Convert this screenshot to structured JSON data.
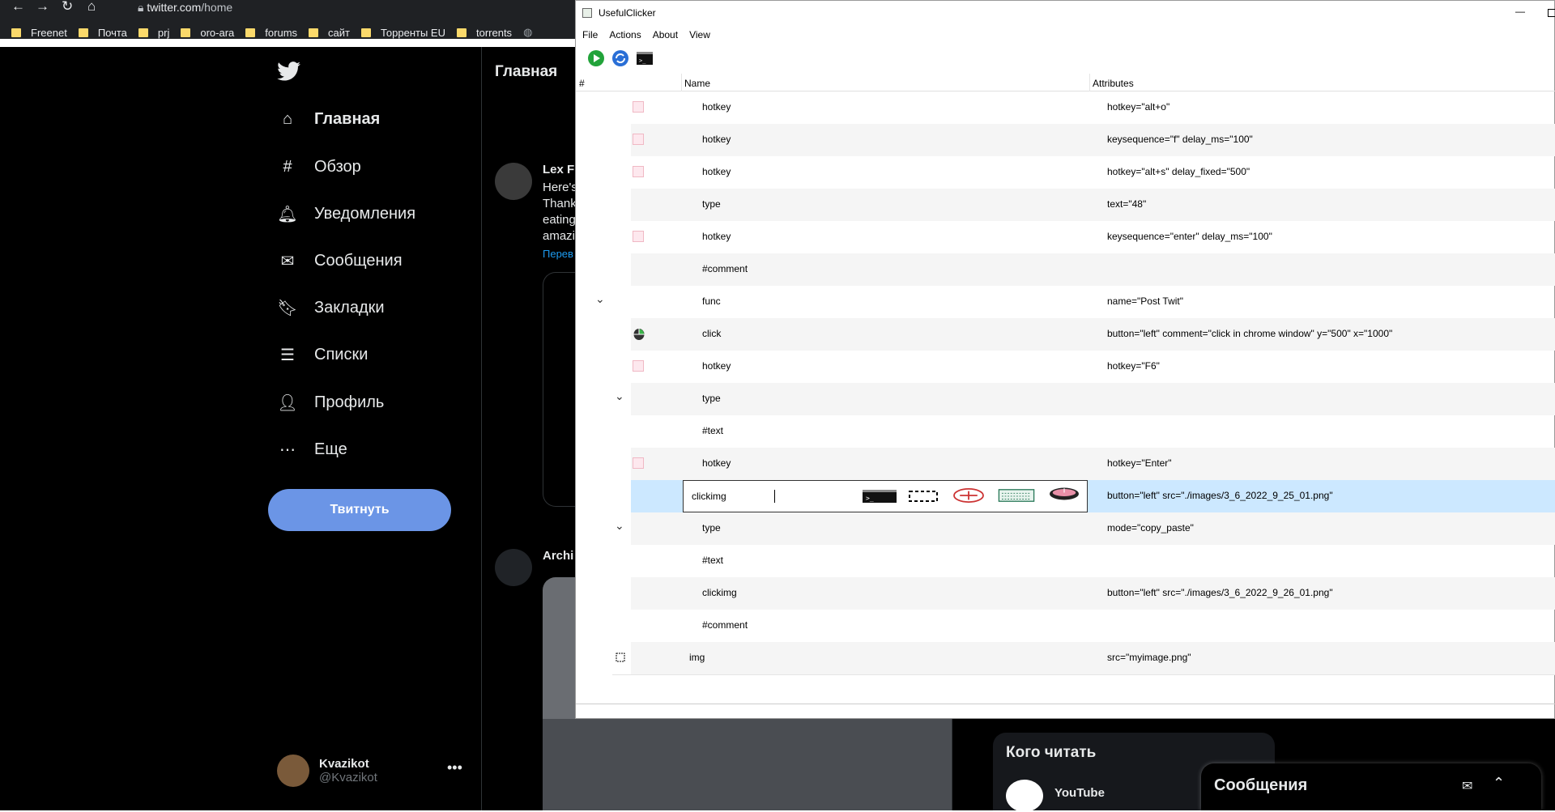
{
  "browser": {
    "url_host": "twitter.com",
    "url_path": "/home",
    "bookmarks": [
      "Freenet",
      "Почта",
      "prj",
      "oro-ara",
      "forums",
      "сайт",
      "Торренты EU",
      "torrents"
    ]
  },
  "twitter": {
    "nav": [
      {
        "label": "Главная",
        "icon": "home-icon"
      },
      {
        "label": "Обзор",
        "icon": "hashtag-icon"
      },
      {
        "label": "Уведомления",
        "icon": "bell-icon"
      },
      {
        "label": "Сообщения",
        "icon": "mail-icon"
      },
      {
        "label": "Закладки",
        "icon": "bookmark-icon"
      },
      {
        "label": "Списки",
        "icon": "list-icon"
      },
      {
        "label": "Профиль",
        "icon": "person-icon"
      },
      {
        "label": "Еще",
        "icon": "more-circle-icon"
      }
    ],
    "tweet_button": "Твитнуть",
    "user_name": "Kvazikot",
    "user_handle": "@Kvazikot",
    "main_title": "Главная",
    "feed": {
      "author1": "Lex F",
      "lines": [
        "Here's",
        "Thank",
        "eating",
        "amazi"
      ],
      "translate": "Перев",
      "author2": "Archi"
    },
    "who_to_follow": "Кого читать",
    "youtube": "YouTube",
    "messages_drawer": "Сообщения"
  },
  "app": {
    "title": "UsefulClicker",
    "menu": [
      "File",
      "Actions",
      "About",
      "View"
    ],
    "columns": [
      "#",
      "Name",
      "Attributes"
    ],
    "rows": [
      {
        "name": "hotkey",
        "attr": "hotkey=\"alt+o\"",
        "icon": "doc-icon",
        "chev": ""
      },
      {
        "name": "hotkey",
        "attr": "keysequence=\"f\" delay_ms=\"100\"",
        "icon": "doc-icon",
        "chev": ""
      },
      {
        "name": "hotkey",
        "attr": "hotkey=\"alt+s\" delay_fixed=\"500\"",
        "icon": "doc-icon",
        "chev": ""
      },
      {
        "name": "type",
        "attr": "text=\"48\"",
        "icon": "",
        "chev": ""
      },
      {
        "name": "hotkey",
        "attr": "keysequence=\"enter\" delay_ms=\"100\"",
        "icon": "doc-icon",
        "chev": ""
      },
      {
        "name": "#comment",
        "attr": "",
        "icon": "",
        "chev": ""
      },
      {
        "name": "func",
        "attr": "name=\"Post Twit\"",
        "icon": "",
        "chev": "outer"
      },
      {
        "name": "click",
        "attr": "button=\"left\" comment=\"click in chrome window\" y=\"500\" x=\"1000\"",
        "icon": "mouse-icon",
        "chev": ""
      },
      {
        "name": "hotkey",
        "attr": "hotkey=\"F6\"",
        "icon": "doc-icon",
        "chev": ""
      },
      {
        "name": "type",
        "attr": "",
        "icon": "",
        "chev": "inner"
      },
      {
        "name": "#text",
        "attr": "",
        "icon": "",
        "chev": ""
      },
      {
        "name": "hotkey",
        "attr": "hotkey=\"Enter\"",
        "icon": "doc-icon",
        "chev": ""
      },
      {
        "name": "clickimg",
        "attr": "button=\"left\" src=\"./images/3_6_2022_9_25_01.png\"",
        "icon": "",
        "chev": "",
        "editing": true
      },
      {
        "name": "type",
        "attr": "mode=\"copy_paste\"",
        "icon": "",
        "chev": "inner"
      },
      {
        "name": "#text",
        "attr": "",
        "icon": "",
        "chev": ""
      },
      {
        "name": "clickimg",
        "attr": "button=\"left\" src=\"./images/3_6_2022_9_26_01.png\"",
        "icon": "",
        "chev": ""
      },
      {
        "name": "#comment",
        "attr": "",
        "icon": "",
        "chev": ""
      },
      {
        "name": "img",
        "attr": "src=\"myimage.png\"",
        "icon": "select-icon",
        "chev": ""
      }
    ],
    "editor_value": "clickimg"
  }
}
